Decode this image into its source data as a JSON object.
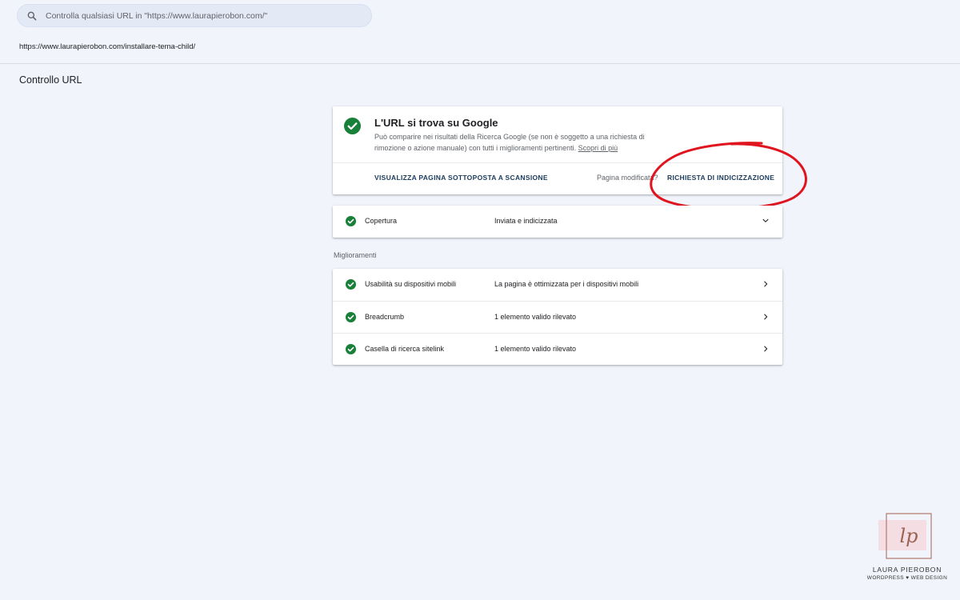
{
  "search": {
    "placeholder": "Controlla qualsiasi URL in \"https://www.laurapierobon.com/\"",
    "icon": "search-icon"
  },
  "current_url": "https://www.laurapierobon.com/installare-tema-child/",
  "page_title": "Controllo URL",
  "status": {
    "title": "L'URL si trova su Google",
    "description": "Può comparire nei risultati della Ricerca Google (se non è soggetto a una richiesta di rimozione o azione manuale) con tutti i miglioramenti pertinenti.",
    "learn_more": "Scopri di più",
    "view_crawled": "VISUALIZZA PAGINA SOTTOPOSTA A SCANSIONE",
    "page_modified": "Pagina modificata?",
    "request_indexing": "RICHIESTA DI INDICIZZAZIONE"
  },
  "coverage": {
    "label": "Copertura",
    "value": "Inviata e indicizzata"
  },
  "enhancements": {
    "section_label": "Miglioramenti",
    "rows": [
      {
        "label": "Usabilità su dispositivi mobili",
        "value": "La pagina è ottimizzata per i dispositivi mobili"
      },
      {
        "label": "Breadcrumb",
        "value": "1 elemento valido rilevato"
      },
      {
        "label": "Casella di ricerca sitelink",
        "value": "1 elemento valido rilevato"
      }
    ]
  },
  "logo": {
    "mark": "lp",
    "name": "LAURA PIEROBON",
    "tagline": "WORDPRESS ♥ WEB DESIGN"
  },
  "colors": {
    "background": "#f1f4fa",
    "success_green": "#188038",
    "annotation_red": "#e0141e",
    "action_text": "#1a3a5c"
  }
}
